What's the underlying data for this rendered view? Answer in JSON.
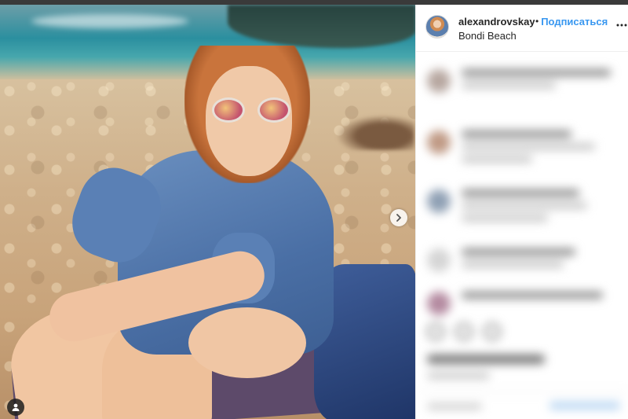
{
  "post": {
    "username": "alexandrovskay",
    "separator": "•",
    "follow_label": "Подписаться",
    "location": "Bondi Beach"
  },
  "icons": {
    "more": "more-horizontal-icon",
    "next": "chevron-right-icon",
    "user_tag": "user-tag-icon"
  },
  "colors": {
    "follow_blue": "#3897f0",
    "username_text": "#262626",
    "panel_bg": "#ffffff"
  }
}
